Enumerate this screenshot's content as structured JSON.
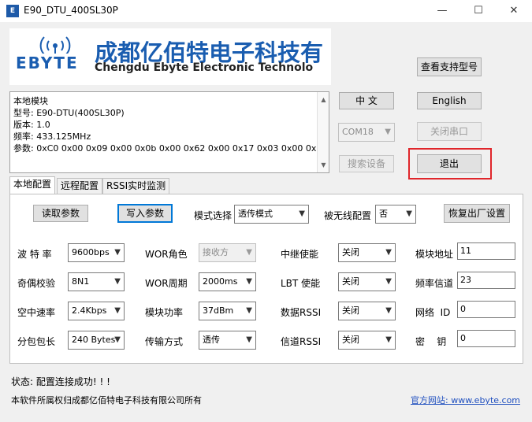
{
  "window": {
    "title": "E90_DTU_400SL30P",
    "icon_text": "E",
    "minimize": "—",
    "maximize": "☐",
    "close": "✕"
  },
  "logo": {
    "brand": "EBYTE",
    "company_cn": "成都亿佰特电子科技有",
    "company_en": "Chengdu Ebyte Electronic Technolo"
  },
  "info": {
    "lines": [
      "本地模块",
      "型号: E90-DTU(400SL30P)",
      "版本: 1.0",
      "频率: 433.125MHz",
      "参数: 0xC0 0x00 0x09 0x00 0x0b 0x00 0x62 0x00 0x17 0x03 0x00 0x00"
    ]
  },
  "buttons": {
    "supported_models": "查看支持型号",
    "chinese": "中 文",
    "english": "English",
    "close_port": "关闭串口",
    "search_device": "搜索设备",
    "exit": "退出"
  },
  "com_port": "COM18",
  "tabs": [
    "本地配置",
    "远程配置",
    "RSSI实时监测"
  ],
  "toolbar": {
    "read_params": "读取参数",
    "write_params": "写入参数",
    "mode_label": "模式选择",
    "mode_value": "透传模式",
    "wireless_label": "被无线配置",
    "wireless_value": "否",
    "factory_reset": "恢复出厂设置"
  },
  "rows": [
    {
      "l1": "波 特 率",
      "v1": "9600bps",
      "l2": "WOR角色",
      "v2": "接收方",
      "l3": "中继使能",
      "v3": "关闭",
      "l4": "模块地址",
      "v4": "11"
    },
    {
      "l1": "奇偶校验",
      "v1": "8N1",
      "l2": "WOR周期",
      "v2": "2000ms",
      "l3": "LBT 使能",
      "v3": "关闭",
      "l4": "频率信道",
      "v4": "23"
    },
    {
      "l1": "空中速率",
      "v1": "2.4Kbps",
      "l2": "模块功率",
      "v2": "37dBm",
      "l3": "数据RSSI",
      "v3": "关闭",
      "l4": "网络  ID",
      "v4": "0"
    },
    {
      "l1": "分包包长",
      "v1": "240 Bytes",
      "l2": "传输方式",
      "v2": "透传",
      "l3": "信道RSSI",
      "v3": "关闭",
      "l4": "密    钥",
      "v4": "0"
    }
  ],
  "status": "状态: 配置连接成功! ! !",
  "footer": {
    "copyright": "本软件所属权归成都亿佰特电子科技有限公司所有",
    "website": "官方网站: www.ebyte.com"
  },
  "icons": {
    "dropdown": "▼",
    "scroll_up": "▲",
    "scroll_down": "▼"
  },
  "colors": {
    "brand_blue": "#1a5db0",
    "highlight_red": "#e0262b",
    "link_blue": "#1f4fbf"
  }
}
